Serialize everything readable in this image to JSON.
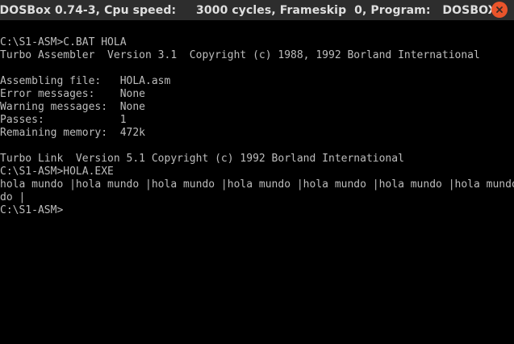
{
  "window": {
    "title": "DOSBox 0.74-3, Cpu speed:     3000 cycles, Frameskip  0, Program:   DOSBOX",
    "close_icon": "close-icon",
    "close_color": "#e9542b"
  },
  "terminal": {
    "background": "#000000",
    "text_color": "#bdbdbd",
    "lines": [
      "C:\\S1-ASM>C.BAT HOLA",
      "Turbo Assembler  Version 3.1  Copyright (c) 1988, 1992 Borland International",
      "",
      "Assembling file:   HOLA.asm",
      "Error messages:    None",
      "Warning messages:  None",
      "Passes:            1",
      "Remaining memory:  472k",
      "",
      "Turbo Link  Version 5.1 Copyright (c) 1992 Borland International",
      "C:\\S1-ASM>HOLA.EXE",
      "hola mundo |hola mundo |hola mundo |hola mundo |hola mundo |hola mundo |hola mundo |hola mun",
      "do |",
      "C:\\S1-ASM>"
    ]
  }
}
